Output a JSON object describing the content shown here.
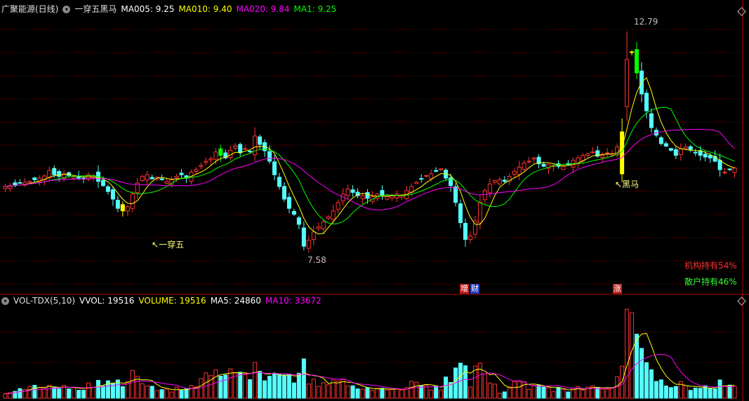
{
  "main_header": {
    "stock": "广聚能源(日线)",
    "indicator": "一穿五黑马",
    "ma5": "MA005: 9.25",
    "ma10": "MA010: 9.40",
    "ma20": "MA020: 9.84",
    "ma1": "MA1: 9.25"
  },
  "vol_header": {
    "name": "VOL-TDX(5,10)",
    "vvol": "VVOL: 19516",
    "volume": "VOLUME: 19516",
    "ma5": "MA5: 24860",
    "ma10": "MA10: 33672"
  },
  "annotations": {
    "high_label": "12.79",
    "low_label": "7.58",
    "signal1": "一穿五",
    "signal2": "黑马",
    "inst": "机构持有54%",
    "retail": "散户持有46%",
    "badge_zeng": "增",
    "badge_cai": "财",
    "badge_zhang": "涨"
  },
  "colors": {
    "up": "#ff3232",
    "down": "#54ffff",
    "ma5": "#ffff00",
    "ma10": "#00ff00",
    "ma20": "#ff00ff",
    "grid": "#800000",
    "signal_yellow": "#ffff00",
    "signal_green": "#00ff00"
  },
  "chart_data": {
    "type": "candlestick",
    "price_range": [
      6.7,
      13.2
    ],
    "high": 12.79,
    "low": 7.58,
    "closes": [
      9.1,
      9.12,
      9.14,
      9.18,
      9.2,
      9.22,
      9.26,
      9.3,
      9.35,
      9.48,
      9.38,
      9.34,
      9.4,
      9.36,
      9.32,
      9.3,
      9.28,
      9.38,
      9.36,
      9.22,
      9.12,
      8.98,
      8.8,
      8.58,
      8.52,
      8.62,
      8.92,
      9.18,
      9.34,
      9.38,
      9.28,
      9.32,
      9.26,
      9.22,
      9.26,
      9.34,
      9.38,
      9.3,
      9.44,
      9.5,
      9.6,
      9.7,
      9.76,
      9.92,
      9.84,
      9.78,
      9.96,
      10.06,
      9.9,
      10.0,
      9.94,
      10.3,
      10.1,
      9.95,
      9.7,
      9.38,
      9.1,
      8.8,
      8.58,
      8.44,
      8.2,
      7.68,
      7.82,
      8.02,
      8.14,
      8.26,
      8.38,
      8.52,
      8.72,
      8.92,
      9.04,
      8.96,
      8.88,
      8.88,
      8.82,
      8.86,
      8.92,
      8.88,
      8.86,
      8.88,
      8.92,
      8.9,
      9.0,
      9.1,
      9.2,
      9.28,
      9.36,
      9.4,
      9.46,
      9.52,
      9.3,
      9.12,
      8.72,
      8.24,
      7.84,
      7.92,
      8.28,
      8.72,
      9.0,
      9.16,
      9.24,
      9.26,
      9.22,
      9.34,
      9.46,
      9.56,
      9.66,
      9.7,
      9.78,
      9.64,
      9.58,
      9.62,
      9.6,
      9.58,
      9.58,
      9.62,
      9.72,
      9.78,
      9.84,
      9.88,
      9.92,
      9.82,
      9.84,
      9.9,
      9.88,
      10.04,
      10.4,
      12.12,
      12.3,
      11.8,
      11.3,
      10.9,
      10.5,
      10.32,
      10.12,
      10.06,
      9.96,
      9.84,
      10.0,
      10.04,
      9.98,
      9.9,
      9.84,
      9.8,
      9.78,
      9.7,
      9.5,
      9.44,
      9.5,
      9.54
    ],
    "signals": [
      {
        "index": 24,
        "type": "一穿五",
        "color": "yellow"
      },
      {
        "index": 44,
        "type": "signal",
        "color": "green"
      },
      {
        "index": 126,
        "type": "黑马",
        "color": "yellow"
      },
      {
        "index": 128,
        "type": "signal",
        "color": "yellow"
      },
      {
        "index": 129,
        "type": "signal",
        "color": "green"
      }
    ]
  }
}
